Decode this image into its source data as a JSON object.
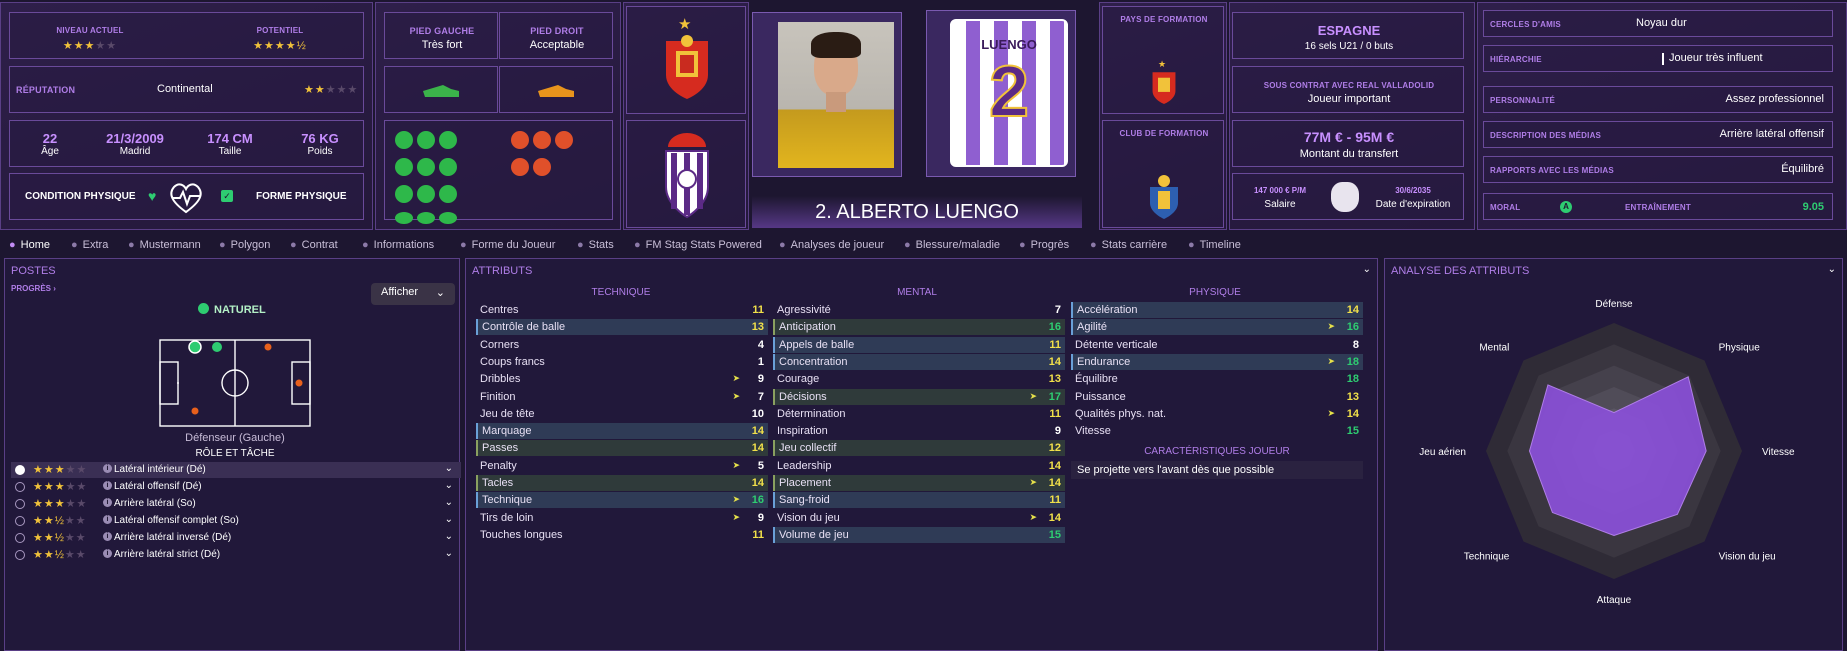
{
  "top": {
    "niveau_label": "NIVEAU ACTUEL",
    "potentiel_label": "POTENTIEL",
    "niveau_stars": "★★★",
    "niveau_off": "★★",
    "potentiel_stars": "★★★★",
    "potentiel_half": "½",
    "reputation_label": "RÉPUTATION",
    "reputation_value": "Continental",
    "reputation_stars": "★★",
    "reputation_off": "★★★",
    "age": "22",
    "age_label": "Âge",
    "dob": "21/3/2009",
    "dob_place": "Madrid",
    "height": "174 CM",
    "height_label": "Taille",
    "weight": "76 KG",
    "weight_label": "Poids",
    "condition_label": "CONDITION PHYSIQUE",
    "forme_label": "FORME PHYSIQUE"
  },
  "feet": {
    "left_label": "PIED GAUCHE",
    "left_value": "Très fort",
    "right_label": "PIED DROIT",
    "right_value": "Acceptable"
  },
  "player": {
    "name": "2. ALBERTO LUENGO",
    "shirt_name": "LUENGO",
    "shirt_number": "2"
  },
  "formation": {
    "pays_label": "PAYS DE FORMATION",
    "club_label": "CLUB DE FORMATION"
  },
  "contract": {
    "country": "ESPAGNE",
    "caps": "16 sels U21 / 0 buts",
    "contract_label": "SOUS CONTRAT AVEC REAL VALLADOLID",
    "contract_status": "Joueur important",
    "value": "77M € - 95M €",
    "value_label": "Montant du transfert",
    "salary": "147 000 € P/M",
    "salary_label": "Salaire",
    "expiry": "30/6/2035",
    "expiry_label": "Date d'expiration"
  },
  "info": {
    "rows": [
      {
        "label": "CERCLES D'AMIS",
        "value": "Noyau dur"
      },
      {
        "label": "HIÉRARCHIE",
        "value": "Joueur très influent"
      },
      {
        "label": "PERSONNALITÉ",
        "value": "Assez professionnel"
      },
      {
        "label": "DESCRIPTION DES MÉDIAS",
        "value": "Arrière latéral offensif"
      },
      {
        "label": "RAPPORTS AVEC LES MÉDIAS",
        "value": "Équilibré"
      }
    ],
    "moral_label": "MORAL",
    "moral_value": "A",
    "training_label": "ENTRAÎNEMENT",
    "training_value": "9.05"
  },
  "tabs": [
    "Home",
    "Extra",
    "Mustermann",
    "Polygon",
    "Contrat",
    "Informations",
    "Forme du Joueur",
    "Stats",
    "FM Stag Stats Powered",
    "Analyses de joueur",
    "Blessure/maladie",
    "Progrès",
    "Stats carrière",
    "Timeline"
  ],
  "postes": {
    "title": "POSTES",
    "progres": "PROGRÈS",
    "afficher": "Afficher",
    "naturel": "NATUREL",
    "position": "Défenseur (Gauche)",
    "role_title": "RÔLE ET TÂCHE",
    "roles": [
      {
        "stars": "★★★",
        "off": "★★",
        "name": "Latéral intérieur (Dé)"
      },
      {
        "stars": "★★★",
        "off": "★★",
        "name": "Latéral offensif (Dé)"
      },
      {
        "stars": "★★★",
        "off": "★★",
        "name": "Arrière latéral (So)"
      },
      {
        "stars": "★★½",
        "off": "★★",
        "name": "Latéral offensif complet (So)"
      },
      {
        "stars": "★★½",
        "off": "★★",
        "name": "Arrière latéral inversé (Dé)"
      },
      {
        "stars": "★★½",
        "off": "★★",
        "name": "Arrière latéral strict (Dé)"
      }
    ]
  },
  "attributes": {
    "title": "ATTRIBUTS",
    "technique_label": "TECHNIQUE",
    "mental_label": "MENTAL",
    "physique_label": "PHYSIQUE",
    "technique": [
      {
        "name": "Centres",
        "value": "11",
        "hl": ""
      },
      {
        "name": "Contrôle de balle",
        "value": "13",
        "hl": "hl"
      },
      {
        "name": "Corners",
        "value": "4",
        "hl": ""
      },
      {
        "name": "Coups francs",
        "value": "1",
        "hl": ""
      },
      {
        "name": "Dribbles",
        "value": "9",
        "hl": "",
        "arrow": "➤"
      },
      {
        "name": "Finition",
        "value": "7",
        "hl": "",
        "arrow": "➤"
      },
      {
        "name": "Jeu de tête",
        "value": "10",
        "hl": ""
      },
      {
        "name": "Marquage",
        "value": "14",
        "hl": "hl"
      },
      {
        "name": "Passes",
        "value": "14",
        "hl": "hg"
      },
      {
        "name": "Penalty",
        "value": "5",
        "hl": "",
        "arrow": "➤"
      },
      {
        "name": "Tacles",
        "value": "14",
        "hl": "hg"
      },
      {
        "name": "Technique",
        "value": "16",
        "hl": "hl",
        "arrow": "➤"
      },
      {
        "name": "Tirs de loin",
        "value": "9",
        "hl": "",
        "arrow": "➤"
      },
      {
        "name": "Touches longues",
        "value": "11",
        "hl": ""
      }
    ],
    "mental": [
      {
        "name": "Agressivité",
        "value": "7",
        "hl": ""
      },
      {
        "name": "Anticipation",
        "value": "16",
        "hl": "hg"
      },
      {
        "name": "Appels de balle",
        "value": "11",
        "hl": "hl"
      },
      {
        "name": "Concentration",
        "value": "14",
        "hl": "hl"
      },
      {
        "name": "Courage",
        "value": "13",
        "hl": ""
      },
      {
        "name": "Décisions",
        "value": "17",
        "hl": "hg",
        "arrow": "➤"
      },
      {
        "name": "Détermination",
        "value": "11",
        "hl": ""
      },
      {
        "name": "Inspiration",
        "value": "9",
        "hl": ""
      },
      {
        "name": "Jeu collectif",
        "value": "12",
        "hl": "hg"
      },
      {
        "name": "Leadership",
        "value": "14",
        "hl": ""
      },
      {
        "name": "Placement",
        "value": "14",
        "hl": "hg",
        "arrow": "➤"
      },
      {
        "name": "Sang-froid",
        "value": "11",
        "hl": "hl"
      },
      {
        "name": "Vision du jeu",
        "value": "14",
        "hl": "",
        "arrow": "➤"
      },
      {
        "name": "Volume de jeu",
        "value": "15",
        "hl": "hl"
      }
    ],
    "physique": [
      {
        "name": "Accélération",
        "value": "14",
        "hl": "hl"
      },
      {
        "name": "Agilité",
        "value": "16",
        "hl": "hl",
        "arrow": "➤"
      },
      {
        "name": "Détente verticale",
        "value": "8",
        "hl": ""
      },
      {
        "name": "Endurance",
        "value": "18",
        "hl": "hl",
        "arrow": "➤"
      },
      {
        "name": "Équilibre",
        "value": "18",
        "hl": ""
      },
      {
        "name": "Puissance",
        "value": "13",
        "hl": ""
      },
      {
        "name": "Qualités phys. nat.",
        "value": "14",
        "hl": "",
        "arrow": "➤"
      },
      {
        "name": "Vitesse",
        "value": "15",
        "hl": ""
      }
    ],
    "traits_label": "CARACTÉRISTIQUES JOUEUR",
    "trait": "Se projette vers l'avant dès que possible"
  },
  "analysis": {
    "title": "ANALYSE DES ATTRIBUTS",
    "axes": [
      "Défense",
      "Physique",
      "Vitesse",
      "Vision du jeu",
      "Attaque",
      "Technique",
      "Jeu aérien",
      "Mental"
    ],
    "values": [
      0.3,
      0.82,
      0.72,
      0.7,
      0.66,
      0.68,
      0.66,
      0.73
    ]
  },
  "colors": {
    "accent": "#b07ee8",
    "green": "#2ecc71",
    "yellow": "#f1c23a"
  }
}
